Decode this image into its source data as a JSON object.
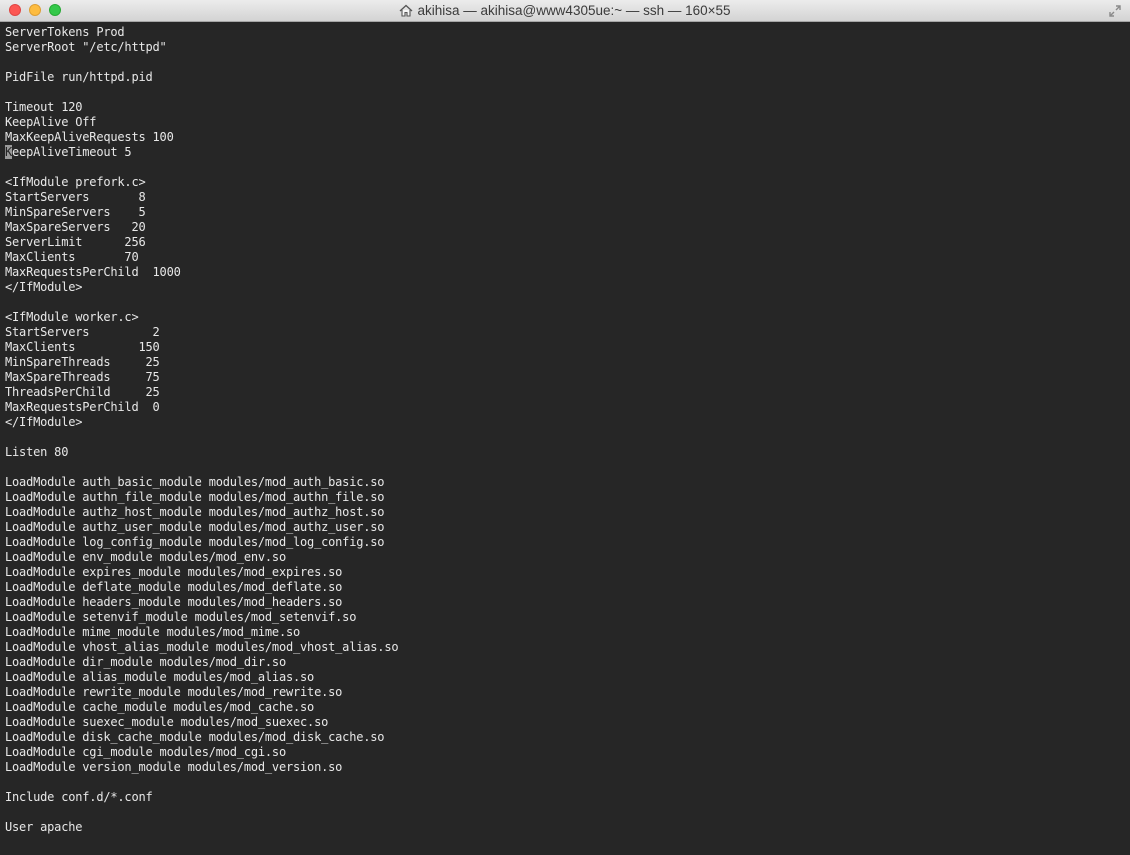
{
  "window": {
    "title": "akihisa — akihisa@www4305ue:~ — ssh — 160×55"
  },
  "terminal": {
    "cursor_line": 8,
    "cursor_char": "K",
    "cursor_rest": "eepAliveTimeout 5",
    "lines": [
      "ServerTokens Prod",
      "ServerRoot \"/etc/httpd\"",
      "",
      "PidFile run/httpd.pid",
      "",
      "Timeout 120",
      "KeepAlive Off",
      "MaxKeepAliveRequests 100",
      "KeepAliveTimeout 5",
      "",
      "<IfModule prefork.c>",
      "StartServers       8",
      "MinSpareServers    5",
      "MaxSpareServers   20",
      "ServerLimit      256",
      "MaxClients       70",
      "MaxRequestsPerChild  1000",
      "</IfModule>",
      "",
      "<IfModule worker.c>",
      "StartServers         2",
      "MaxClients         150",
      "MinSpareThreads     25",
      "MaxSpareThreads     75",
      "ThreadsPerChild     25",
      "MaxRequestsPerChild  0",
      "</IfModule>",
      "",
      "Listen 80",
      "",
      "LoadModule auth_basic_module modules/mod_auth_basic.so",
      "LoadModule authn_file_module modules/mod_authn_file.so",
      "LoadModule authz_host_module modules/mod_authz_host.so",
      "LoadModule authz_user_module modules/mod_authz_user.so",
      "LoadModule log_config_module modules/mod_log_config.so",
      "LoadModule env_module modules/mod_env.so",
      "LoadModule expires_module modules/mod_expires.so",
      "LoadModule deflate_module modules/mod_deflate.so",
      "LoadModule headers_module modules/mod_headers.so",
      "LoadModule setenvif_module modules/mod_setenvif.so",
      "LoadModule mime_module modules/mod_mime.so",
      "LoadModule vhost_alias_module modules/mod_vhost_alias.so",
      "LoadModule dir_module modules/mod_dir.so",
      "LoadModule alias_module modules/mod_alias.so",
      "LoadModule rewrite_module modules/mod_rewrite.so",
      "LoadModule cache_module modules/mod_cache.so",
      "LoadModule suexec_module modules/mod_suexec.so",
      "LoadModule disk_cache_module modules/mod_disk_cache.so",
      "LoadModule cgi_module modules/mod_cgi.so",
      "LoadModule version_module modules/mod_version.so",
      "",
      "Include conf.d/*.conf",
      "",
      "User apache"
    ]
  },
  "colors": {
    "background": "#262626",
    "foreground": "#e8e8e8",
    "cursor": "#9a9a9a"
  },
  "icons": [
    "close-button",
    "minimize-button",
    "zoom-button",
    "home-icon",
    "fullscreen-icon"
  ]
}
